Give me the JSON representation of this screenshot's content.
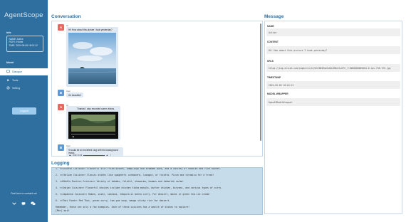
{
  "app": {
    "logo": "AgentScope"
  },
  "sidebar": {
    "info_title": "Info",
    "info_lines": [
      "NAME: Active",
      "PATH: /Home",
      "TIME: 2024-05-05 18:01:12"
    ],
    "model_title": "Model",
    "nav": [
      {
        "label": "Dialogue",
        "icon": "dialogue-icon",
        "active": true
      },
      {
        "label": "Tools",
        "icon": "tools-icon",
        "active": false
      },
      {
        "label": "Setting",
        "icon": "setting-icon",
        "active": false
      }
    ],
    "logout_label": "Logout",
    "contact_label": "Feel free to contact us!",
    "contact_icons": [
      "github-icon",
      "chat-icon",
      "wechat-icon"
    ]
  },
  "conversation": {
    "title": "Conversation",
    "messages": [
      {
        "avatar": "A",
        "role": "ai",
        "name": "AI",
        "text": "Hi! How about this picture I took yesterday?"
      },
      {
        "avatar": "B",
        "role": "user",
        "name": "User",
        "text": "It's beautiful!"
      },
      {
        "avatar": "A",
        "role": "ai",
        "name": "AI",
        "text": "Thanks! I also recorded some videos."
      },
      {
        "avatar": "B",
        "role": "user",
        "name": "User",
        "text": "It would be an excellent vlog with this background music."
      }
    ],
    "audio_time": "0:00 / 0:23"
  },
  "logging": {
    "title": "Logging",
    "lines": [
      "1. <<Chinese Cuisine>> Flavorful stir-fried dishes, dumplings and steamed buns, and a variety of noodles and rice dishes.",
      "2. <<Italian Cuisine>> Classic dishes like spaghetti carbonara, lasagna, or risotto. Pizza and tiramisu for a treat!",
      "3. <<Middle Eastern Cuisine>> Variety of kebabs, falafel, shawarma, hummus and tabouleh salad.",
      "4. <<Indian Cuisine>> Flavorful choices include chicken tikka masala, butter chicken, biryani, and various types of curry.",
      "5. <<Japanese Cuisine>> Ramen, sushi, sashimi, tempura or bento curry. For dessert, mochi or green tea ice cream!",
      "6. <<Thai Food>> Pad Thai, green curry, tom yum soup, mango sticky rice for dessert.",
      "Remember, these are only a few examples. Each of these cuisines has a wealth of dishes to explore!",
      "[Mar] quit"
    ]
  },
  "message": {
    "title": "Message",
    "fields": [
      {
        "label": "NAME",
        "value": "Active"
      },
      {
        "label": "CONTENT",
        "value": "Hi! How about this picture I took yesterday?"
      },
      {
        "label": "URLS",
        "value": "https://img.alicdn.com/imgextra/i3/O1CN01RmeXvDa1RNnSlwS7V_!!6000000005604-0-tps-736-725.jpg"
      },
      {
        "label": "TIMESTAMP",
        "value": "2024-05-05 18:01:12"
      },
      {
        "label": "MODEL WRAPPER",
        "value": "OpenAIModelWrapper"
      }
    ]
  },
  "colors": {
    "sidebar_bg": "#2f6f9f",
    "accent": "#2f6f9f",
    "ai_avatar": "#e8685f",
    "user_avatar": "#5b9bd5",
    "bubble_bg": "#dfe9f3",
    "log_bg": "#c7dcea"
  }
}
